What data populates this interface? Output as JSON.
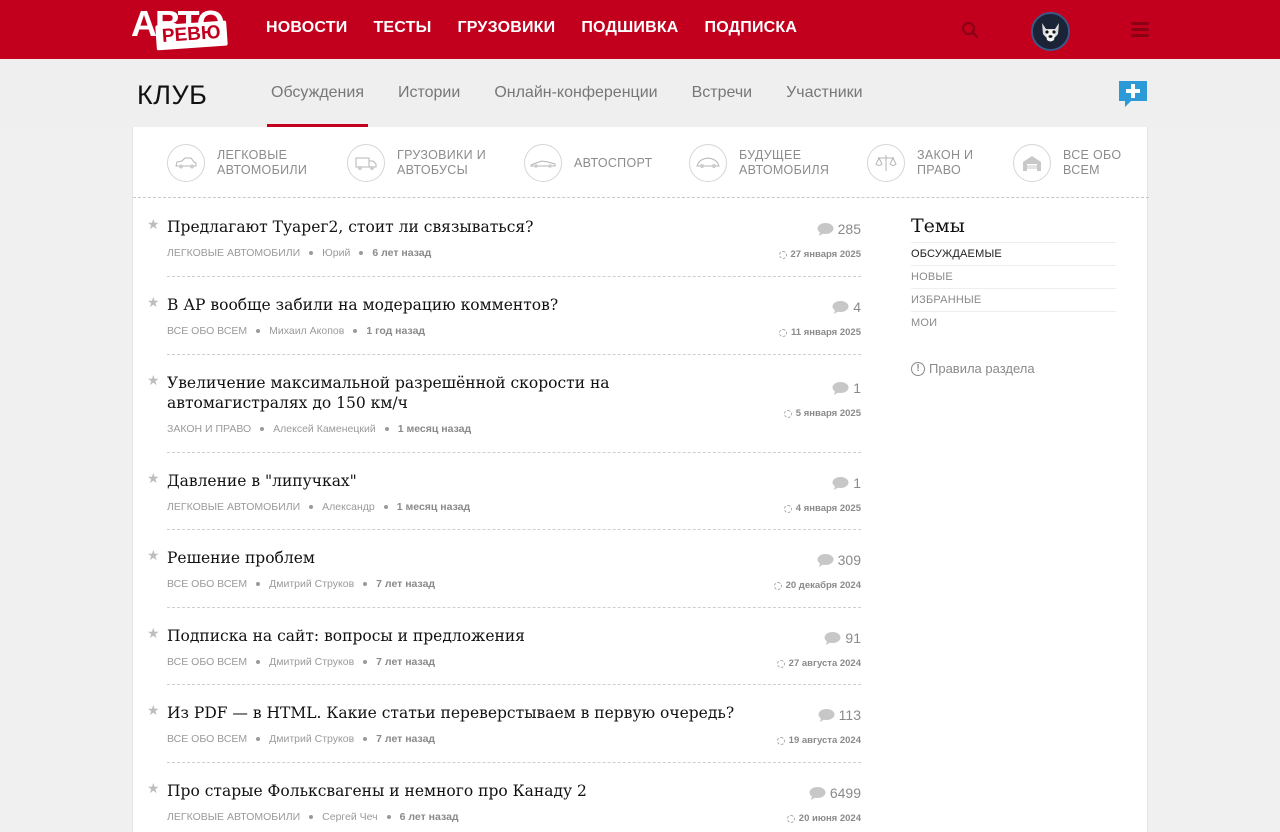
{
  "header": {
    "logo_top": "АВТО",
    "logo_bottom": "РЕВЮ",
    "nav": [
      "НОВОСТИ",
      "ТЕСТЫ",
      "ГРУЗОВИКИ",
      "ПОДШИВКА",
      "ПОДПИСКА"
    ],
    "icons": {
      "search": "search-icon",
      "avatar": "user-avatar",
      "menu": "hamburger-menu-icon"
    },
    "colors": {
      "brand": "#c2001e",
      "accent_blue": "#2c9ad7"
    }
  },
  "club": {
    "title": "КЛУБ",
    "tabs": [
      "Обсуждения",
      "Истории",
      "Онлайн-конференции",
      "Встречи",
      "Участники"
    ],
    "active_tab": "Обсуждения"
  },
  "categories": [
    {
      "label": "ЛЕГКОВЫЕ\nАВТОМОБИЛИ",
      "icon": "car-icon"
    },
    {
      "label": "ГРУЗОВИКИ И\nАВТОБУСЫ",
      "icon": "truck-icon"
    },
    {
      "label": "АВТОСПОРТ",
      "icon": "race-car-icon"
    },
    {
      "label": "БУДУЩЕЕ\nАВТОМОБИЛЯ",
      "icon": "future-car-icon"
    },
    {
      "label": "ЗАКОН И\nПРАВО",
      "icon": "scales-icon"
    },
    {
      "label": "ВСЕ ОБО\nВСЕМ",
      "icon": "garage-icon"
    }
  ],
  "topics": [
    {
      "title": "Предлагают Туарег2, стоит ли связываться?",
      "category": "ЛЕГКОВЫЕ АВТОМОБИЛИ",
      "author": "Юрий",
      "ago": "6 лет назад",
      "count": "285",
      "date": "27 января 2025"
    },
    {
      "title": "В АР вообще забили на модерацию комментов?",
      "category": "ВСЕ ОБО ВСЕМ",
      "author": "Михаил Акопов",
      "ago": "1 год назад",
      "count": "4",
      "date": "11 января 2025"
    },
    {
      "title": "Увеличение максимальной разрешённой скорости на автомагистралях до 150 км/ч",
      "category": "ЗАКОН И ПРАВО",
      "author": "Алексей Каменецкий",
      "ago": "1 месяц назад",
      "count": "1",
      "date": "5 января 2025"
    },
    {
      "title": "Давление в \"липучках\"",
      "category": "ЛЕГКОВЫЕ АВТОМОБИЛИ",
      "author": "Александр",
      "ago": "1 месяц назад",
      "count": "1",
      "date": "4 января 2025"
    },
    {
      "title": "Решение проблем",
      "category": "ВСЕ ОБО ВСЕМ",
      "author": "Дмитрий Струков",
      "ago": "7 лет назад",
      "count": "309",
      "date": "20 декабря 2024"
    },
    {
      "title": "Подписка на сайт: вопросы и предложения",
      "category": "ВСЕ ОБО ВСЕМ",
      "author": "Дмитрий Струков",
      "ago": "7 лет назад",
      "count": "91",
      "date": "27 августа 2024"
    },
    {
      "title": "Из PDF — в HTML. Какие статьи переверстываем в первую очередь?",
      "category": "ВСЕ ОБО ВСЕМ",
      "author": "Дмитрий Струков",
      "ago": "7 лет назад",
      "count": "113",
      "date": "19 августа 2024"
    },
    {
      "title": "Про старые Фольксвагены и немного про Канаду 2",
      "category": "ЛЕГКОВЫЕ АВТОМОБИЛИ",
      "author": "Сергей Чеч",
      "ago": "6 лет назад",
      "count": "6499",
      "date": "20 июня 2024"
    }
  ],
  "sidebar": {
    "title": "Темы",
    "filters": [
      "ОБСУЖДАЕМЫЕ",
      "НОВЫЕ",
      "ИЗБРАННЫЕ",
      "МОИ"
    ],
    "active_filter": "ОБСУЖДАЕМЫЕ",
    "rules": "Правила раздела"
  }
}
